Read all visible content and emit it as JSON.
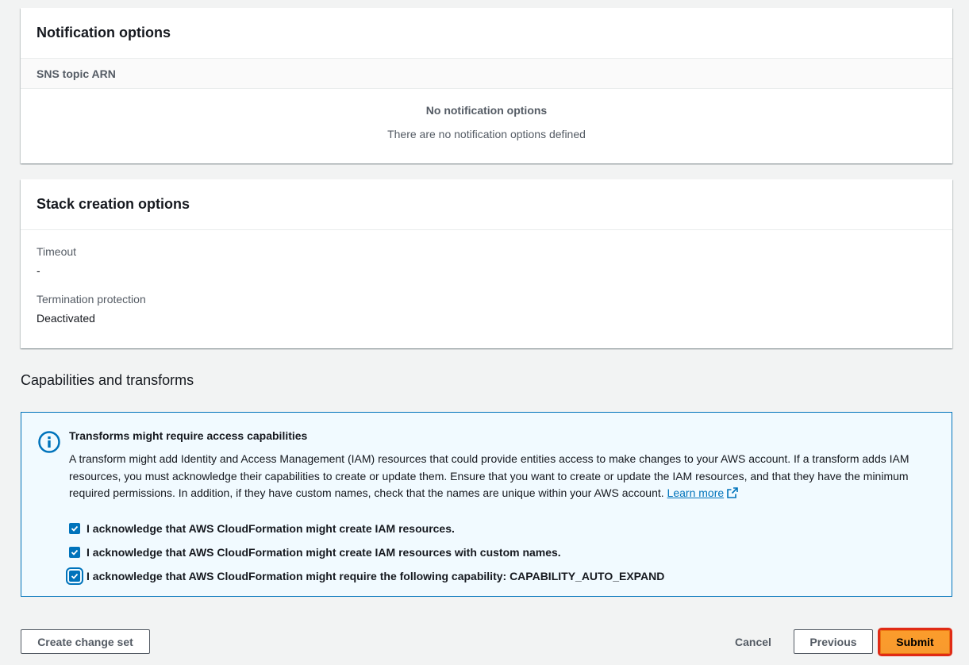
{
  "notification": {
    "title": "Notification options",
    "column_header": "SNS topic ARN",
    "empty_title": "No notification options",
    "empty_desc": "There are no notification options defined"
  },
  "stack_creation": {
    "title": "Stack creation options",
    "timeout_label": "Timeout",
    "timeout_value": "-",
    "termination_label": "Termination protection",
    "termination_value": "Deactivated"
  },
  "capabilities": {
    "heading": "Capabilities and transforms",
    "info_title": "Transforms might require access capabilities",
    "info_text": "A transform might add Identity and Access Management (IAM) resources that could provide entities access to make changes to your AWS account. If a transform adds IAM resources, you must acknowledge their capabilities to create or update them. Ensure that you want to create or update the IAM resources, and that they have the minimum required permissions. In addition, if they have custom names, check that the names are unique within your AWS account.",
    "learn_more": "Learn more",
    "checkboxes": [
      {
        "label": "I acknowledge that AWS CloudFormation might create IAM resources.",
        "checked": true
      },
      {
        "label": "I acknowledge that AWS CloudFormation might create IAM resources with custom names.",
        "checked": true
      },
      {
        "label": "I acknowledge that AWS CloudFormation might require the following capability: CAPABILITY_AUTO_EXPAND",
        "checked": true
      }
    ]
  },
  "actions": {
    "create_change_set": "Create change set",
    "cancel": "Cancel",
    "previous": "Previous",
    "submit": "Submit"
  },
  "colors": {
    "accent": "#0073bb",
    "primary_button": "#ec7211",
    "highlight": "#e02b15",
    "background": "#f2f3f3"
  }
}
